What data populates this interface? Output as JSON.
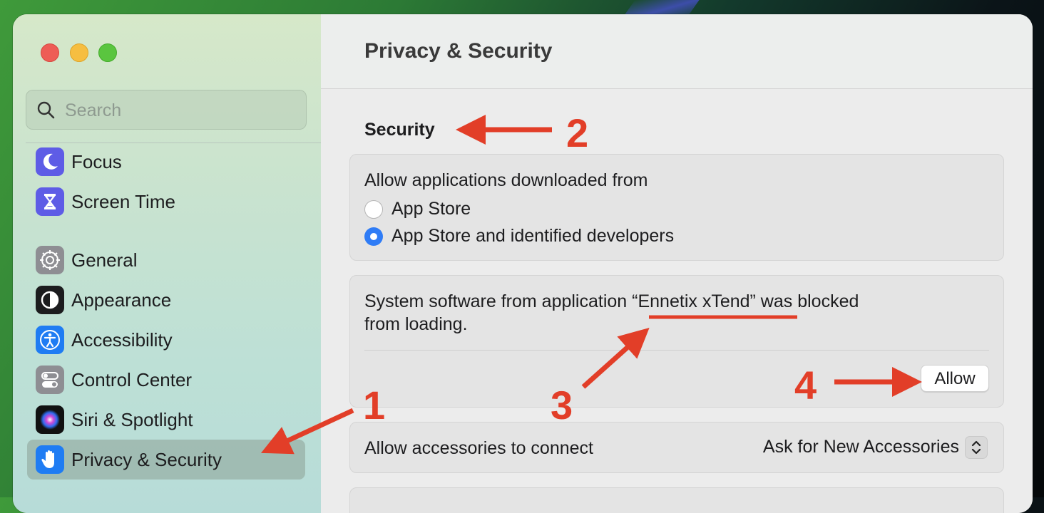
{
  "window": {
    "title": "Privacy & Security"
  },
  "sidebar": {
    "search_placeholder": "Search",
    "items": [
      {
        "label": "Focus",
        "icon": "moon-icon"
      },
      {
        "label": "Screen Time",
        "icon": "hourglass-icon"
      },
      {
        "label": "General",
        "icon": "gear-icon"
      },
      {
        "label": "Appearance",
        "icon": "appearance-icon"
      },
      {
        "label": "Accessibility",
        "icon": "accessibility-icon"
      },
      {
        "label": "Control Center",
        "icon": "toggles-icon"
      },
      {
        "label": "Siri & Spotlight",
        "icon": "siri-icon"
      },
      {
        "label": "Privacy & Security",
        "icon": "hand-icon",
        "selected": true
      }
    ]
  },
  "main": {
    "section_title": "Security",
    "downloads": {
      "label": "Allow applications downloaded from",
      "options": [
        {
          "label": "App Store",
          "selected": false
        },
        {
          "label": "App Store and identified developers",
          "selected": true
        }
      ]
    },
    "blocked": {
      "line1_prefix": "System software from application ",
      "app_name": "“Ennetix xTend”",
      "line1_suffix": " was blocked",
      "line2": "from loading.",
      "button": "Allow"
    },
    "accessories": {
      "label": "Allow accessories to connect",
      "value": "Ask for New Accessories"
    }
  },
  "annotations": {
    "numbers": [
      "1",
      "2",
      "3",
      "4"
    ],
    "color": "#e23e28"
  },
  "colors": {
    "accent": "#2f7cf6",
    "annotation": "#e23e28"
  }
}
